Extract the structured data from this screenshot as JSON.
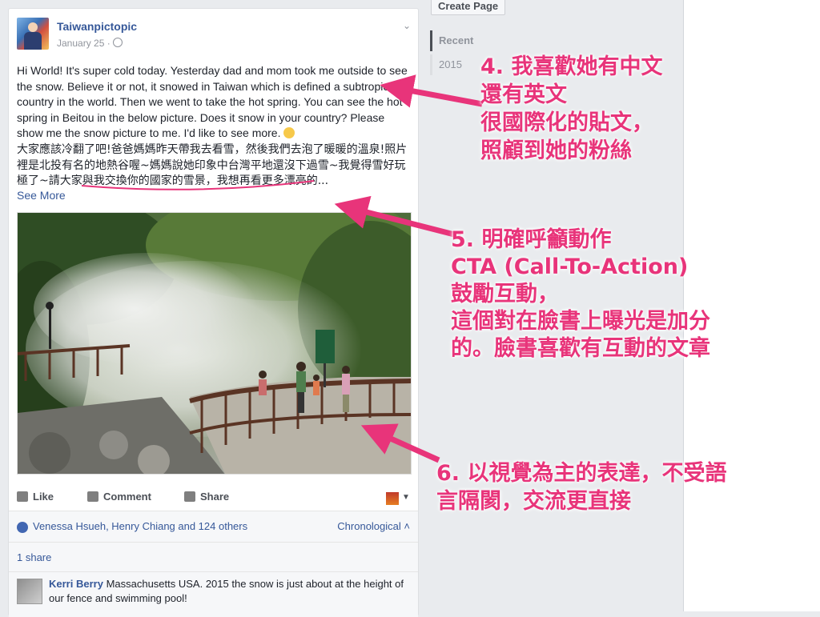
{
  "sidebar": {
    "create_page": "Create Page",
    "nav": [
      {
        "label": "Recent"
      },
      {
        "label": "2015"
      }
    ]
  },
  "post": {
    "page_name": "Taiwanpictopic",
    "date": "January 25 ·",
    "text_en": "Hi World! It's super cold today. Yesterday dad and mom took me outside to see the snow. Believe it or not, it snowed in Taiwan which is defined a subtropical country in the world. Then we went to take the hot spring. You can see the hot spring in Beitou in the below picture. Does it snow in your country? Please show me the snow picture to me. I'd like to see more.",
    "text_zh": "大家應該冷翻了吧!爸爸媽媽昨天帶我去看雪，然後我們去泡了暖暖的溫泉!照片裡是北投有名的地熱谷喔~媽媽說她印象中台灣平地還沒下過雪~我覺得雪好玩極了~請大家與我交換你的國家的雪景，我想再看更多漂亮的...",
    "see_more": "See More",
    "photo_alt": "hot-spring-photo",
    "sign_text": "本區溫泉請勿手入",
    "actions": {
      "like": "Like",
      "comment": "Comment",
      "share": "Share"
    },
    "likes": "Venessa Hsueh, Henry Chiang and 124 others",
    "sort": "Chronological",
    "shares": "1 share",
    "comment": {
      "author": "Kerri Berry",
      "text": "Massachusetts USA. 2015 the snow is just about at the height of our fence and swimming pool!"
    }
  },
  "annotations": {
    "a4": [
      "4. 我喜歡她有中文",
      "還有英文",
      "很國際化的貼文，",
      "照顧到她的粉絲"
    ],
    "a5": [
      "5. 明確呼籲動作",
      "CTA (Call-To-Action)",
      "鼓勵互動，",
      "這個對在臉書上曝光是加分",
      "的。臉書喜歡有互動的文章"
    ],
    "a6": [
      "6. 以視覺為主的表達，不受語",
      "言隔閡，交流更直接"
    ]
  },
  "colors": {
    "annotation": "#e8347a",
    "link": "#365899",
    "accent_line": "#e8347a"
  }
}
